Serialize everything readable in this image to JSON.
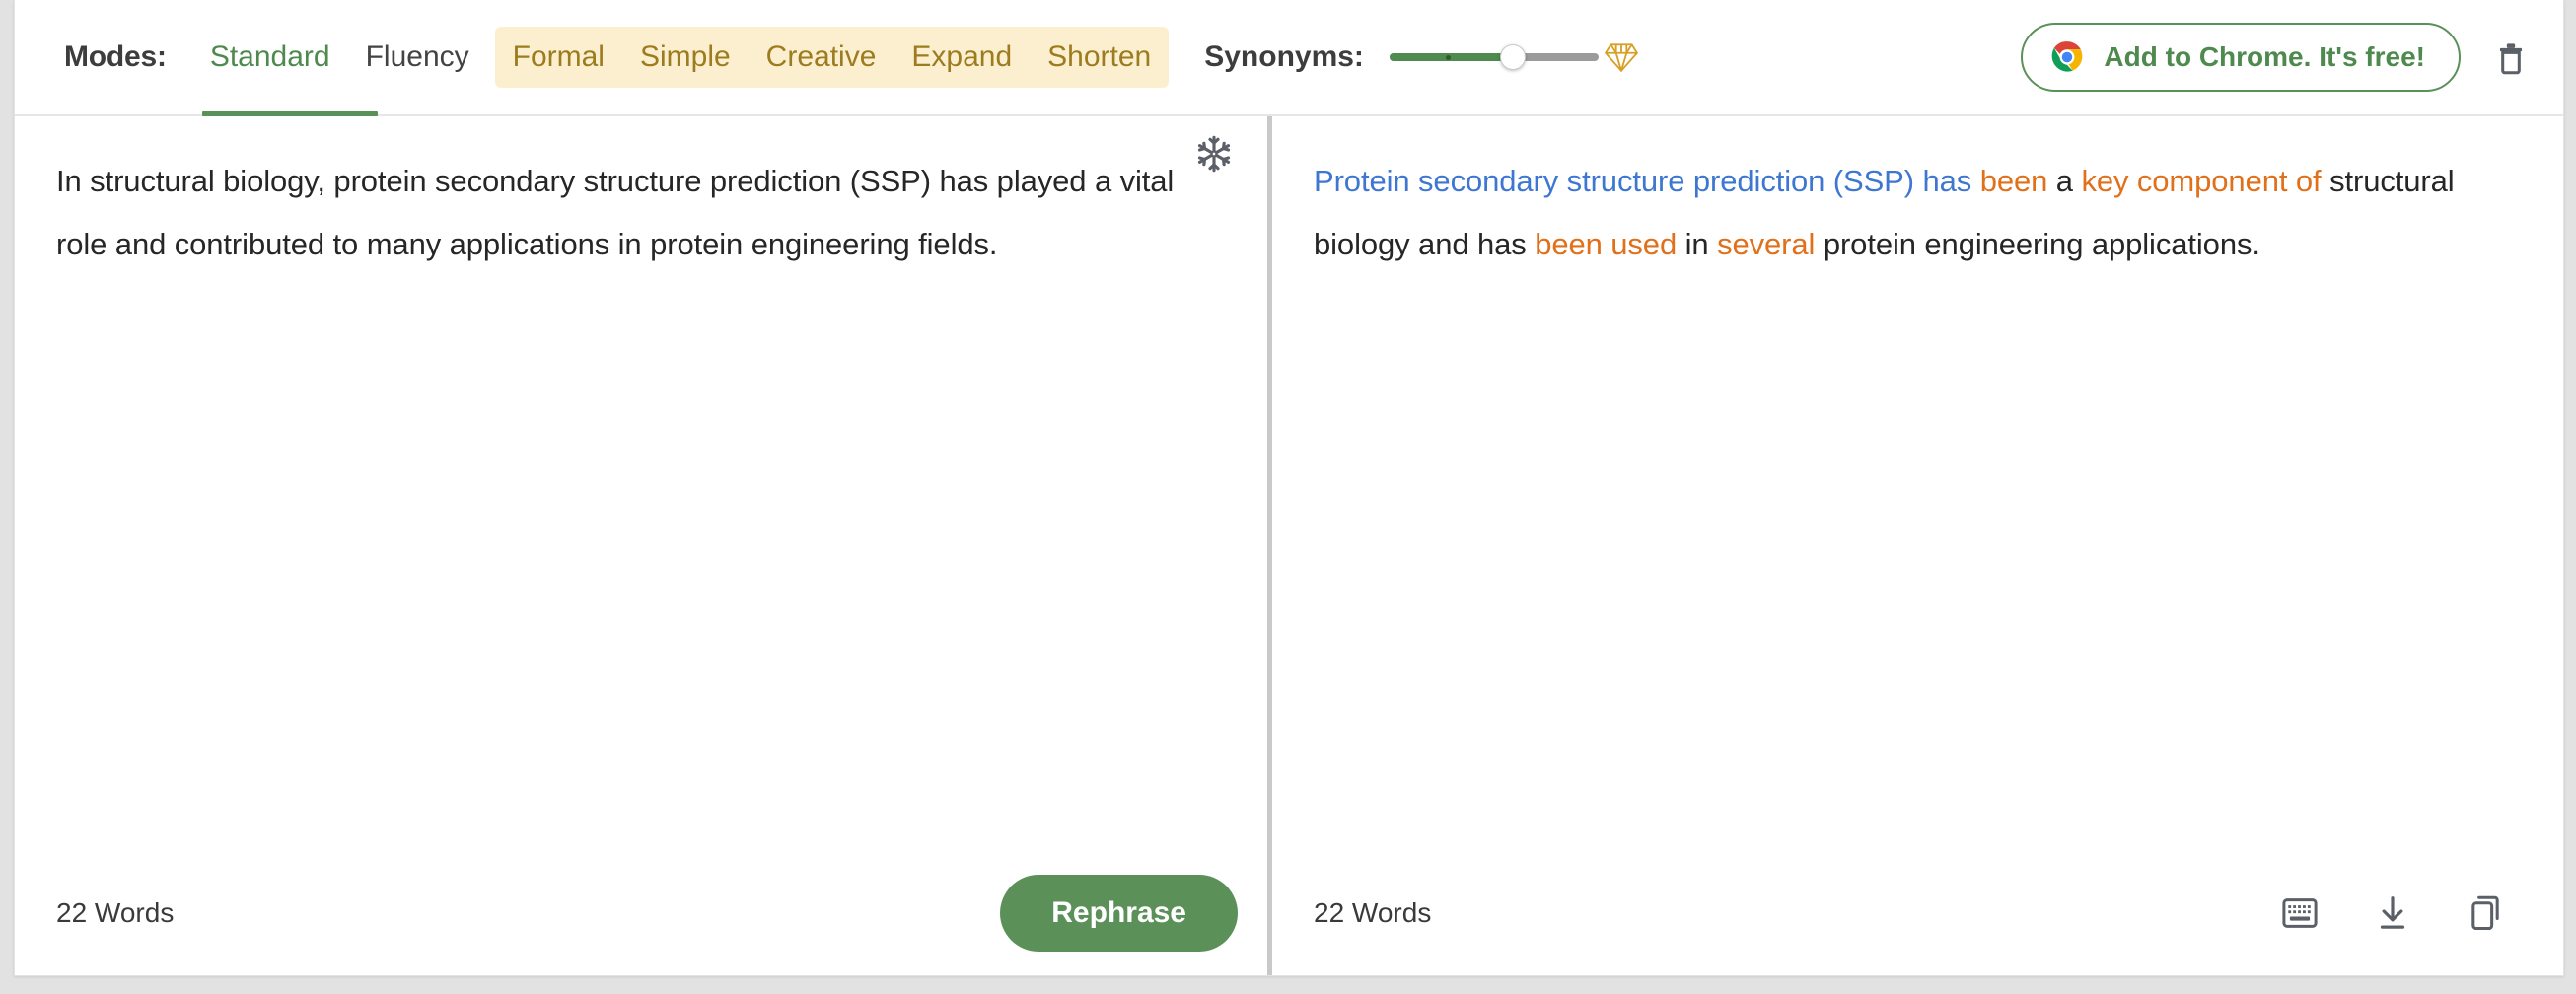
{
  "toolbar": {
    "modes_label": "Modes:",
    "modes": [
      {
        "label": "Standard",
        "state": "active",
        "premium": false
      },
      {
        "label": "Fluency",
        "state": "default",
        "premium": false
      },
      {
        "label": "Formal",
        "state": "premium",
        "premium": true
      },
      {
        "label": "Simple",
        "state": "premium",
        "premium": true
      },
      {
        "label": "Creative",
        "state": "premium",
        "premium": true
      },
      {
        "label": "Expand",
        "state": "premium",
        "premium": true
      },
      {
        "label": "Shorten",
        "state": "premium",
        "premium": true
      }
    ],
    "synonyms_label": "Synonyms:",
    "slider": {
      "value_percent": 55,
      "fill_color": "#4f8a4e",
      "track_color": "#9b9b9b"
    },
    "diamond_icon": "diamond-icon",
    "chrome_cta": "Add to Chrome. It's free!",
    "chrome_icon": "chrome-logo-icon",
    "trash_icon": "trash-icon"
  },
  "input_panel": {
    "text": "In structural biology, protein secondary structure prediction (SSP) has played a vital role and contributed to many applications in protein engineering fields.",
    "freeze_icon": "snowflake-icon",
    "word_count": "22 Words",
    "rephrase_label": "Rephrase"
  },
  "output_panel": {
    "segments": [
      {
        "text": "Protein secondary structure prediction (SSP) has ",
        "color": "blue"
      },
      {
        "text": "been ",
        "color": "orange"
      },
      {
        "text": "a ",
        "color": "dark"
      },
      {
        "text": "key component of ",
        "color": "orange"
      },
      {
        "text": "structural biology and has ",
        "color": "dark"
      },
      {
        "text": "been used ",
        "color": "orange"
      },
      {
        "text": "in ",
        "color": "dark"
      },
      {
        "text": "several ",
        "color": "orange"
      },
      {
        "text": "protein engineering applications.",
        "color": "dark"
      }
    ],
    "word_count": "22 Words",
    "icons": [
      {
        "name": "keyboard-icon"
      },
      {
        "name": "download-icon"
      },
      {
        "name": "copy-icon"
      }
    ]
  },
  "colors": {
    "accent_green": "#5a9159",
    "premium_gold": "#9c7c1e",
    "premium_bg": "#fbefd0",
    "synonym_blue": "#3d77d1",
    "synonym_orange": "#e1701a"
  }
}
